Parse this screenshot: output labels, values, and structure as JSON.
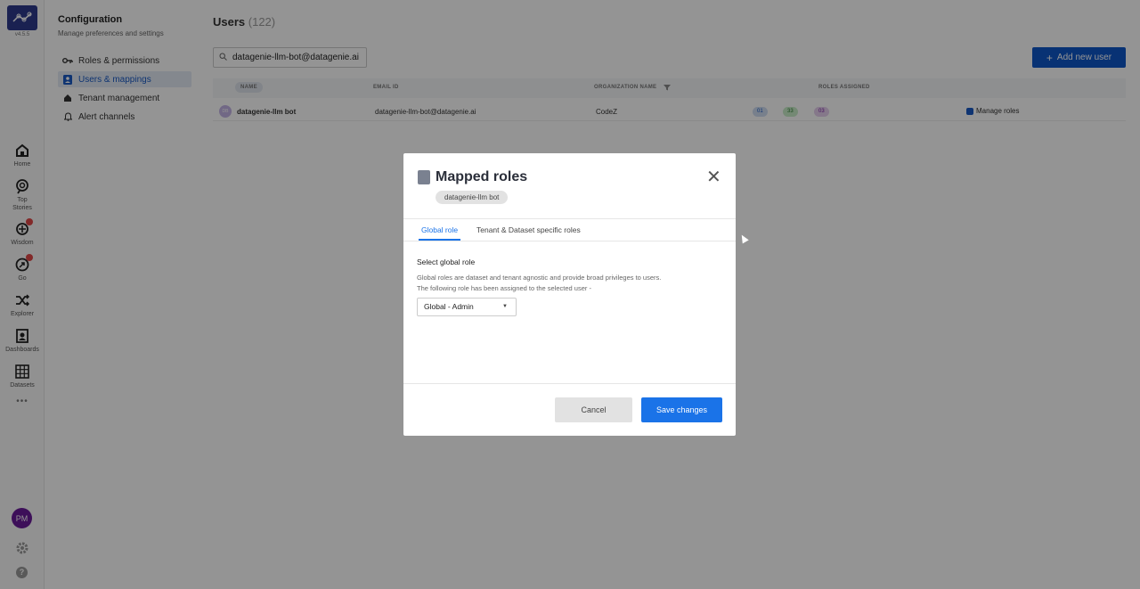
{
  "app": {
    "version": "v4.5.5"
  },
  "rail": {
    "items": [
      {
        "label": "Home",
        "icon": "home-icon"
      },
      {
        "label": "Top\nStories",
        "icon": "top-stories-icon"
      },
      {
        "label": "Wisdom",
        "icon": "wisdom-icon"
      },
      {
        "label": "Go",
        "icon": "go-icon"
      },
      {
        "label": "Explorer",
        "icon": "shuffle-icon"
      },
      {
        "label": "Dashboards",
        "icon": "dashboards-icon"
      },
      {
        "label": "Datasets",
        "icon": "grid-icon"
      }
    ],
    "more": "•••",
    "avatar_initials": "PM",
    "help": "?"
  },
  "config": {
    "title": "Configuration",
    "subtitle": "Manage preferences and settings",
    "items": [
      {
        "label": "Roles & permissions",
        "icon": "key-icon"
      },
      {
        "label": "Users & mappings",
        "icon": "user-badge-icon"
      },
      {
        "label": "Tenant management",
        "icon": "house-icon"
      },
      {
        "label": "Alert channels",
        "icon": "bell-icon"
      }
    ]
  },
  "users": {
    "title": "Users",
    "count": "(122)",
    "search_value": "datagenie-llm-bot@datagenie.ai",
    "add_label": "Add new user",
    "columns": {
      "name": "NAME",
      "email": "EMAIL ID",
      "org": "ORGANIZATION NAME",
      "roles": "ROLES ASSIGNED"
    },
    "rows": [
      {
        "initials": "DB",
        "name": "datagenie-llm bot",
        "email": "datagenie-llm-bot@datagenie.ai",
        "org": "CodeZ",
        "pill1": "01",
        "pill2": "33",
        "pill3": "03",
        "manage": "Manage roles"
      }
    ]
  },
  "modal": {
    "title": "Mapped roles",
    "user_chip": "datagenie-llm bot",
    "tabs": {
      "global": "Global role",
      "tenant": "Tenant & Dataset specific roles"
    },
    "section_title": "Select global role",
    "desc_line1": "Global roles are dataset and tenant agnostic and provide broad privileges to users.",
    "desc_line2": "The following role has been assigned to the selected user -",
    "selected_role": "Global - Admin",
    "cancel": "Cancel",
    "save": "Save changes"
  },
  "colors": {
    "primary": "#1a73e8",
    "brand": "#2d3a8c",
    "add_button": "#0f56c9"
  }
}
